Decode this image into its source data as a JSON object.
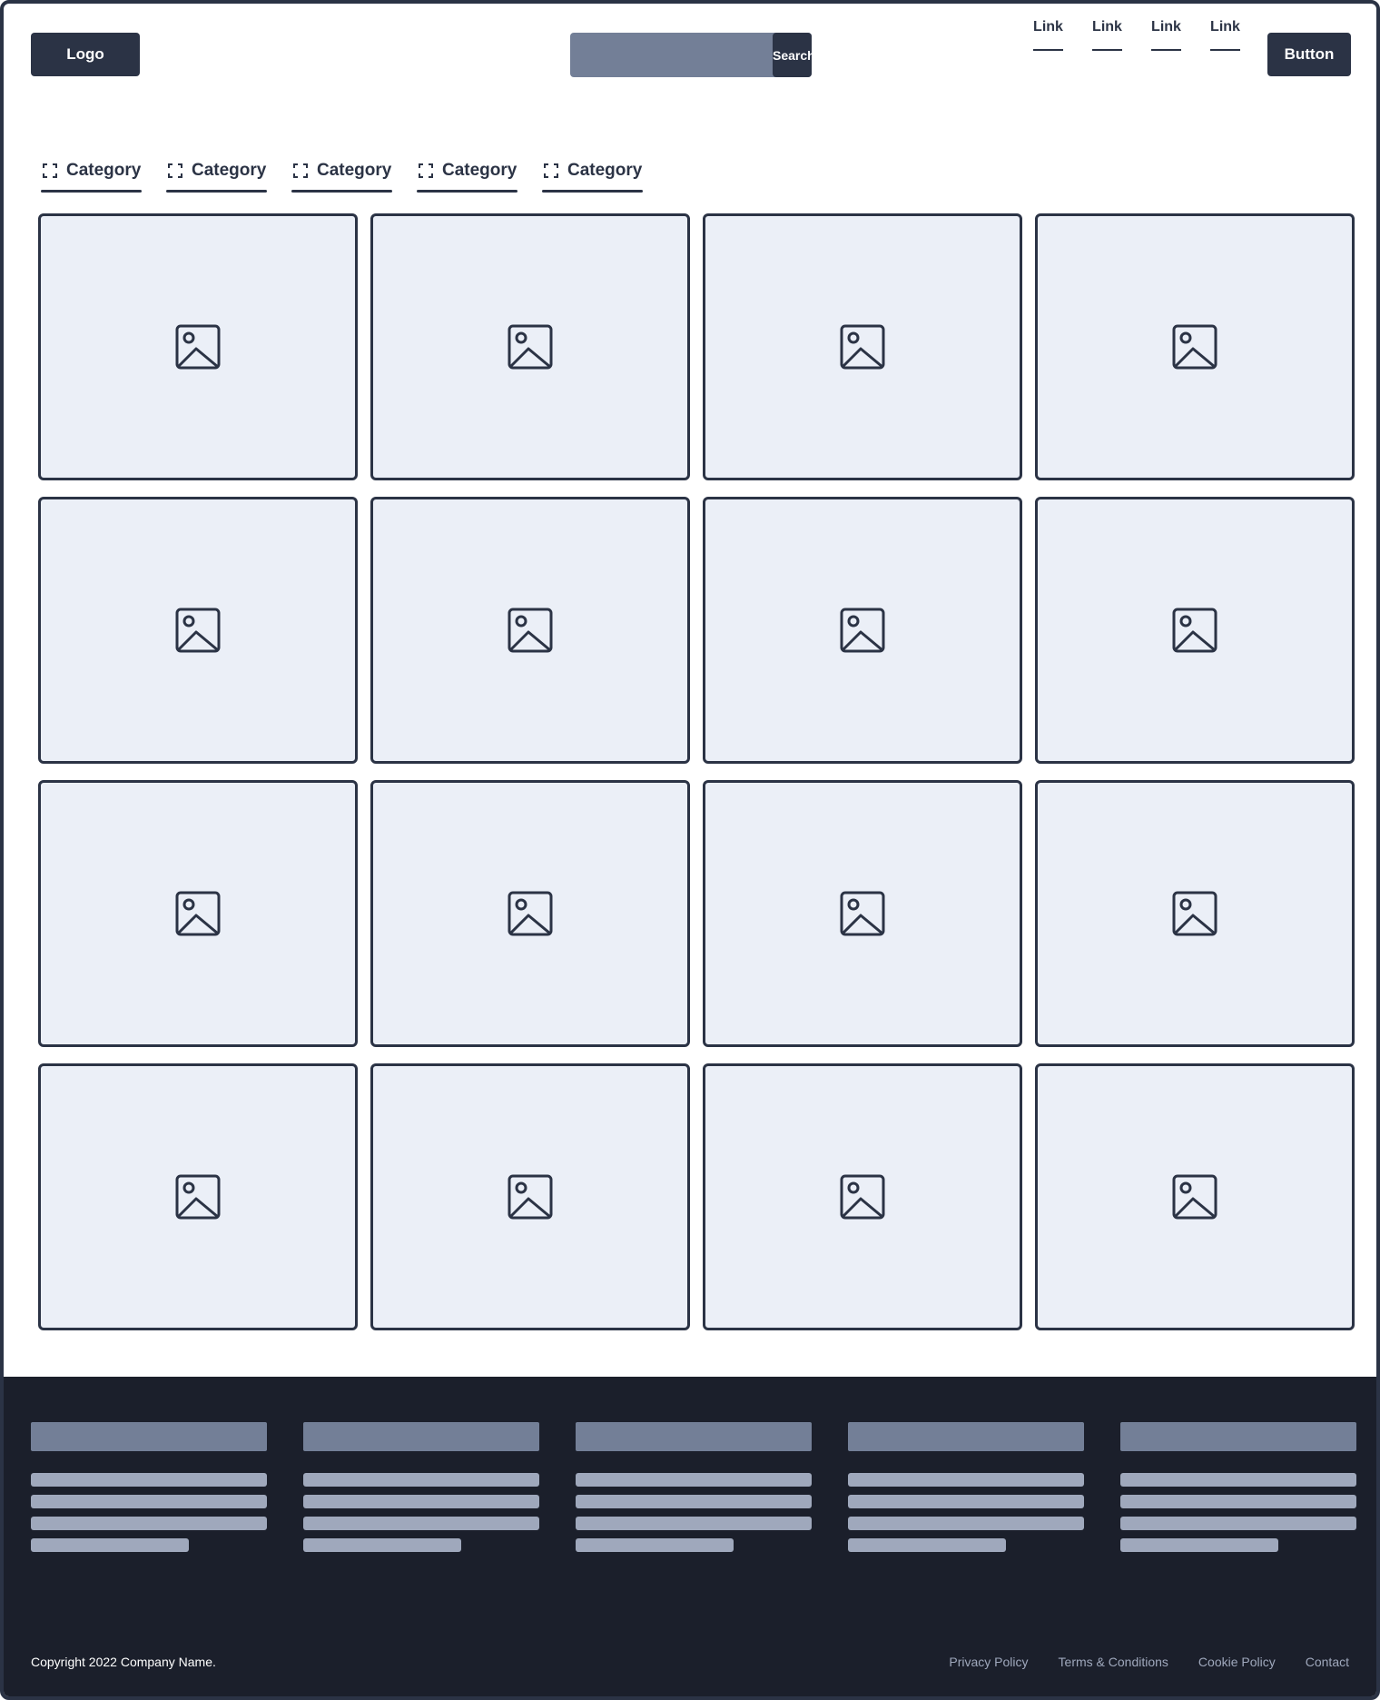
{
  "header": {
    "logo": "Logo",
    "search": {
      "placeholder": "",
      "button_label": "Search"
    },
    "nav_links": [
      "Link",
      "Link",
      "Link",
      "Link"
    ],
    "button_label": "Button"
  },
  "categories": [
    "Category",
    "Category",
    "Category",
    "Category",
    "Category"
  ],
  "gallery": {
    "card_count": 16,
    "columns": 4
  },
  "footer": {
    "copyright": "Copyright 2022 Company Name.",
    "links": [
      "Privacy Policy",
      "Terms & Conditions",
      "Cookie Policy",
      "Contact"
    ]
  },
  "colors": {
    "dark": "#2b3345",
    "card_bg": "#ebeff7",
    "search_bg": "#737f97",
    "footer_bg": "#1b1f2b",
    "placeholder_line": "#9fa8bc"
  }
}
